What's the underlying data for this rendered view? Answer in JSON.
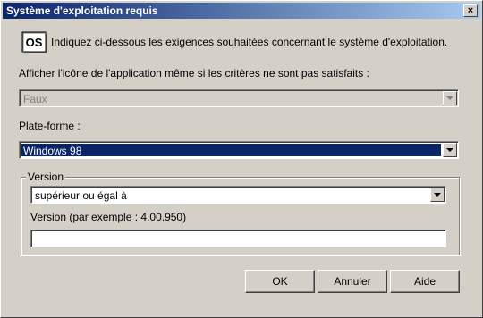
{
  "window": {
    "title": "Système d'exploitation requis",
    "close_label": "×"
  },
  "header": {
    "icon_label": "OS",
    "text": "Indiquez ci-dessous les exigences souhaitées concernant le système d'exploitation."
  },
  "show_icon": {
    "label": "Afficher l'icône de l'application même si les critères ne sont pas satisfaits :",
    "value": "Faux"
  },
  "platform": {
    "label": "Plate-forme :",
    "value": "Windows 98"
  },
  "version_group": {
    "label": "Version",
    "comparator": "supérieur ou égal à",
    "field_label": "Version (par exemple : 4.00.950)",
    "field_value": ""
  },
  "buttons": {
    "ok": "OK",
    "cancel": "Annuler",
    "help": "Aide"
  }
}
